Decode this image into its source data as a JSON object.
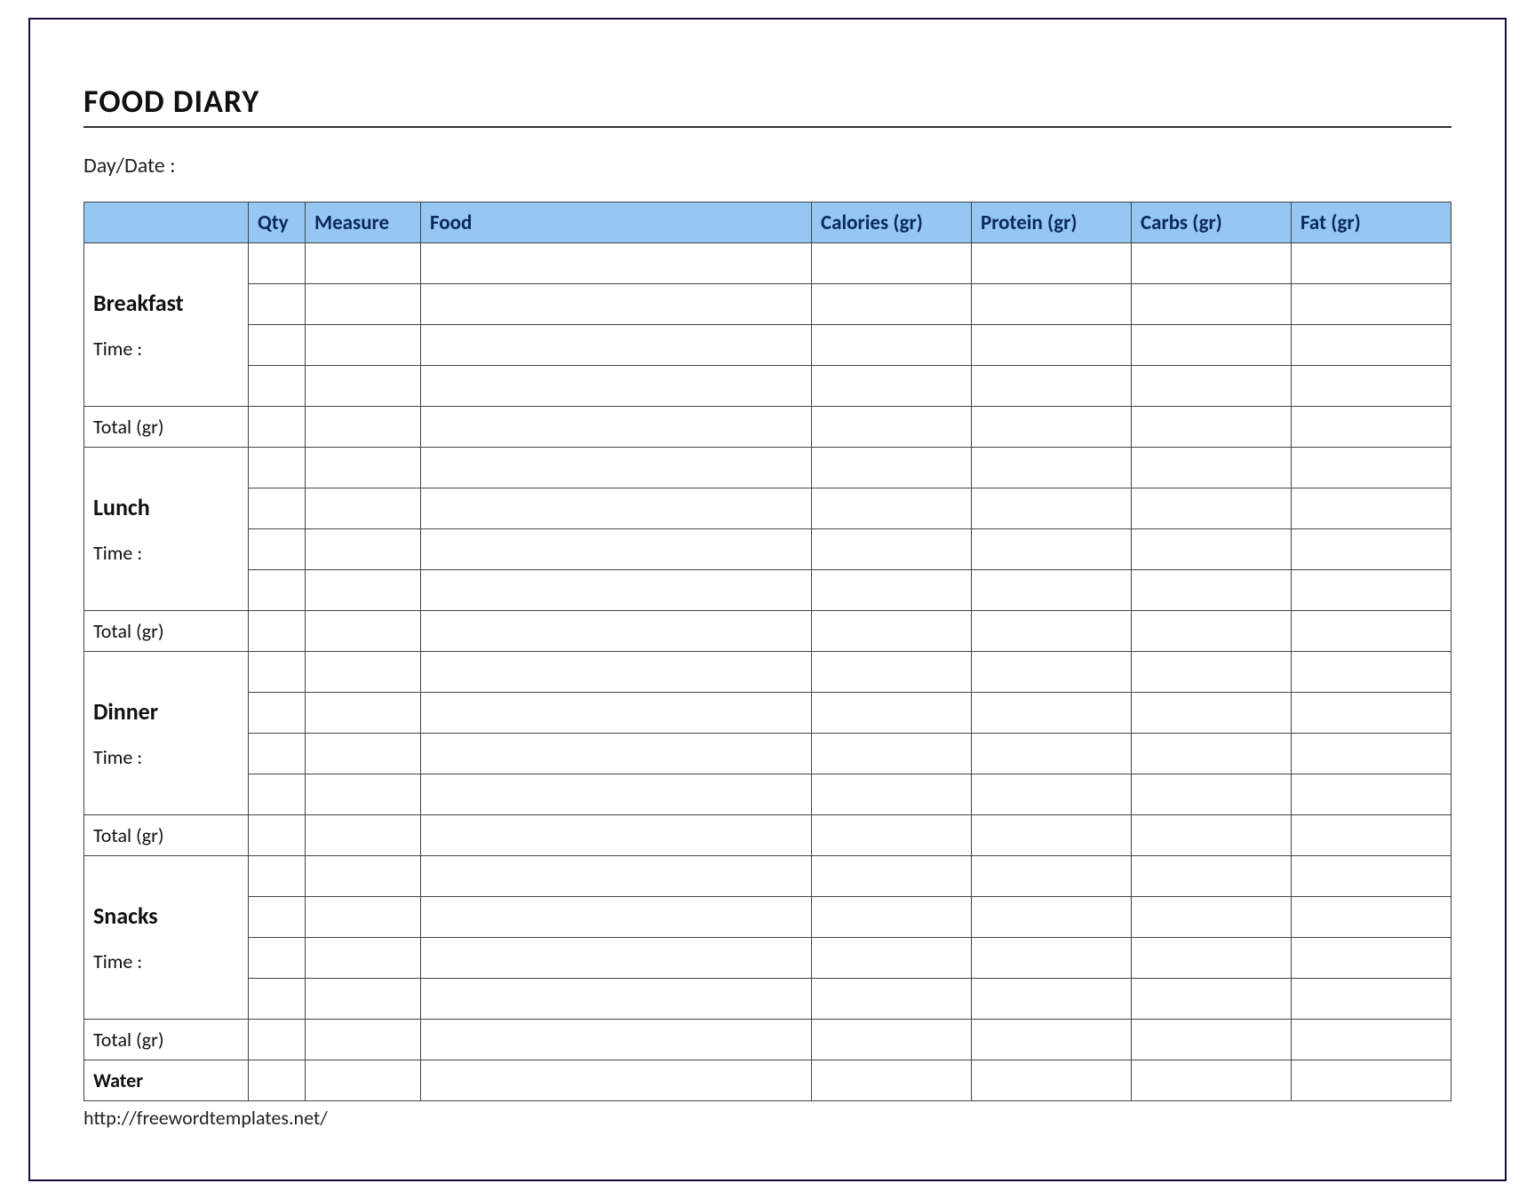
{
  "title": "FOOD DIARY",
  "daydate_label": "Day/Date :",
  "headers": {
    "qty": "Qty",
    "measure": "Measure",
    "food": "Food",
    "calories": "Calories (gr)",
    "protein": "Protein (gr)",
    "carbs": "Carbs (gr)",
    "fat": "Fat (gr)"
  },
  "meals": [
    {
      "name": "Breakfast",
      "time_label": "Time :",
      "total_label": "Total (gr)"
    },
    {
      "name": "Lunch",
      "time_label": "Time :",
      "total_label": "Total (gr)"
    },
    {
      "name": "Dinner",
      "time_label": "Time :",
      "total_label": "Total (gr)"
    },
    {
      "name": "Snacks",
      "time_label": "Time :",
      "total_label": "Total (gr)"
    }
  ],
  "water_label": "Water",
  "footer_url": "http://freewordtemplates.net/"
}
